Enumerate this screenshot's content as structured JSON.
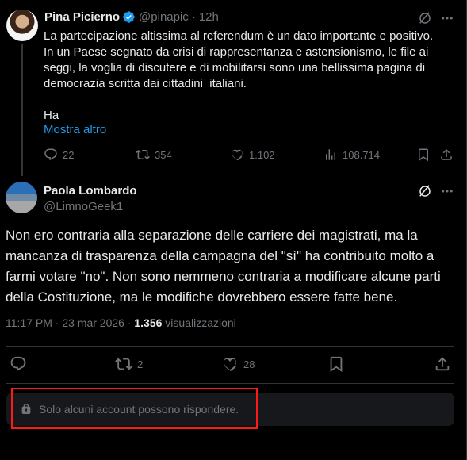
{
  "parent_tweet": {
    "author_name": "Pina Picierno",
    "handle": "@pinapic",
    "separator": "·",
    "time": "12h",
    "text": "La partecipazione altissima al referendum è un dato importante e positivo.\nIn un Paese segnato da crisi di rappresentanza e astensionismo, le file ai\nseggi, la voglia di discutere e di mobilitarsi sono una bellissima pagina di\ndemocrazia scritta dai cittadini  italiani.\n\nHa",
    "show_more": "Mostra altro",
    "replies": "22",
    "reposts": "354",
    "likes": "1.102",
    "views": "108.714"
  },
  "main_tweet": {
    "author_name": "Paola Lombardo",
    "handle": "@LimnoGeek1",
    "text": "Non ero contraria alla separazione delle carriere dei magistrati, ma la mancanza di trasparenza della campagna del \"sì\" ha contribuito molto a farmi votare \"no\". Non sono nemmeno contraria a modificare alcune parti della Costituzione, ma le modifiche dovrebbero essere fatte bene.",
    "timestamp": "11:17 PM · 23 mar 2026 · ",
    "views_count": "1.356",
    "views_label": " visualizzazioni",
    "reposts": "2",
    "likes": "28"
  },
  "reply_restriction": "Solo alcuni account possono rispondere.",
  "colors": {
    "background": "#000000",
    "text": "#e7e9ea",
    "secondary": "#71767b",
    "link": "#1d9bf0",
    "verified": "#1d9bf0",
    "highlight": "#ff1a1a"
  }
}
